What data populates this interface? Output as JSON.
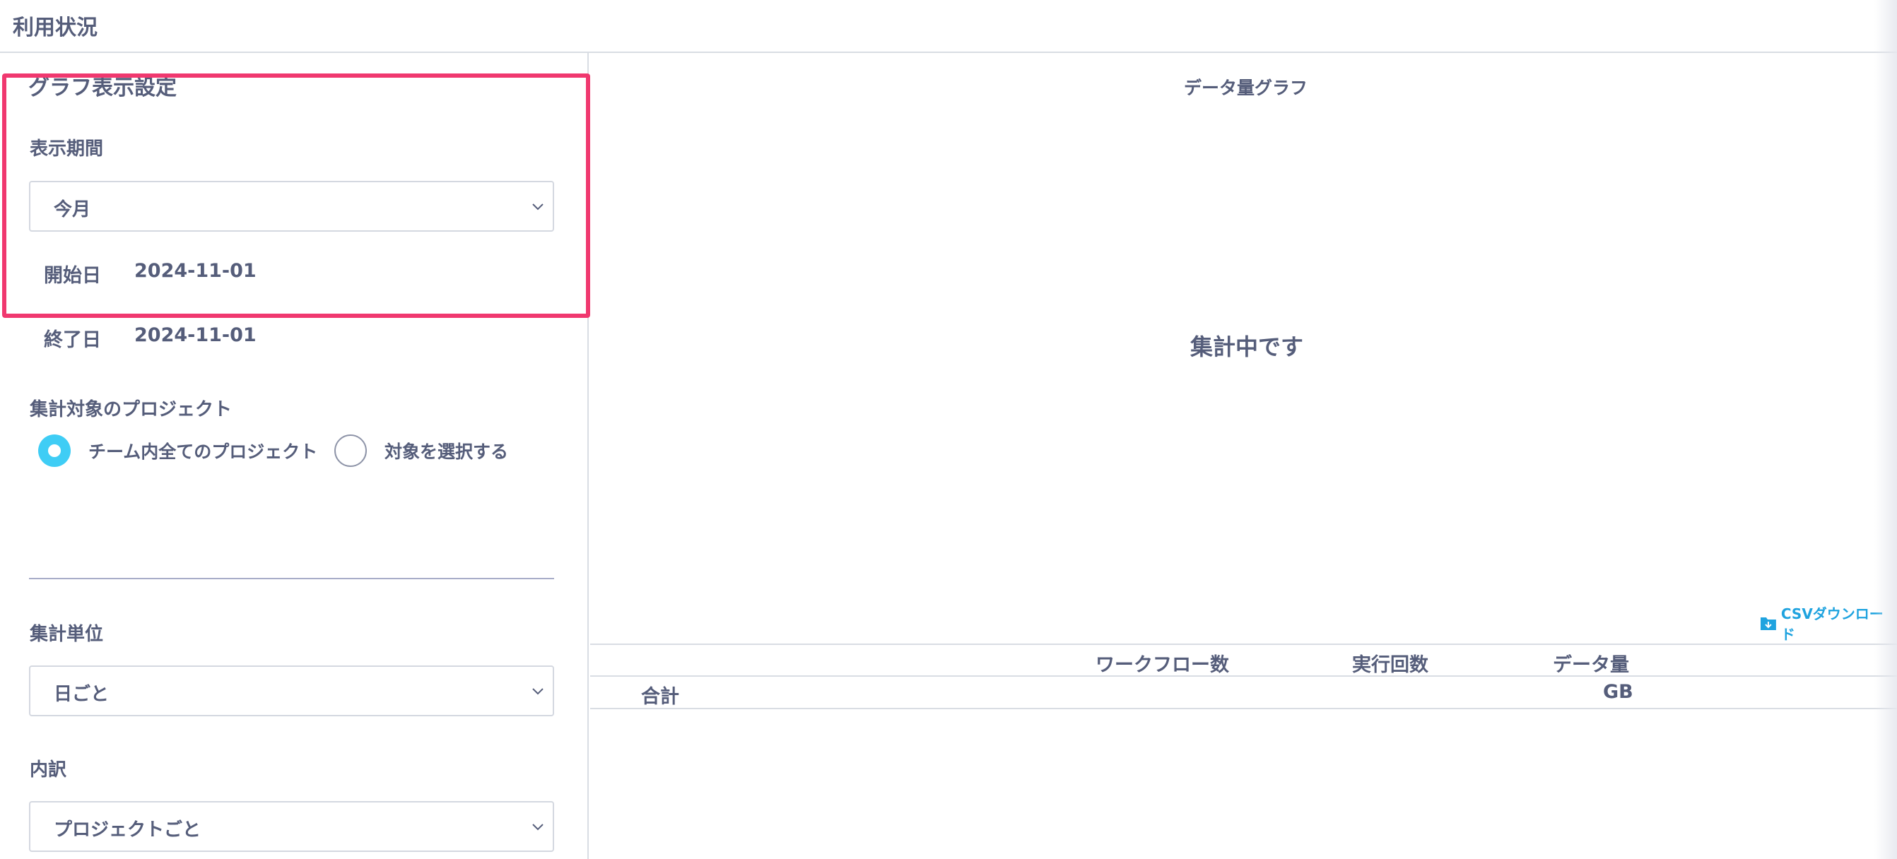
{
  "page": {
    "title": "利用状況"
  },
  "settings": {
    "title": "グラフ表示設定",
    "period": {
      "label": "表示期間",
      "selected": "今月",
      "start_label": "開始日",
      "start_value": "2024-11-01",
      "end_label": "終了日",
      "end_value": "2024-11-01"
    },
    "projects": {
      "label": "集計対象のプロジェクト",
      "options": [
        {
          "label": "チーム内全てのプロジェクト",
          "selected": true
        },
        {
          "label": "対象を選択する",
          "selected": false
        }
      ]
    },
    "unit": {
      "label": "集計単位",
      "selected": "日ごと"
    },
    "breakdown": {
      "label": "内訳",
      "selected": "プロジェクトごと"
    }
  },
  "chart": {
    "title": "データ量グラフ",
    "status": "集計中です"
  },
  "csv": {
    "label": "CSVダウンロード",
    "icon": "folder-download-icon"
  },
  "table": {
    "headers": [
      "ワークフロー数",
      "実行回数",
      "データ量"
    ],
    "rows": [
      {
        "label": "合計",
        "workflows": "",
        "runs": "",
        "data": "GB"
      }
    ]
  },
  "colors": {
    "accent": "#3fcdf5",
    "highlight": "#f0386f",
    "link": "#1fa3df",
    "text": "#555d7a"
  }
}
